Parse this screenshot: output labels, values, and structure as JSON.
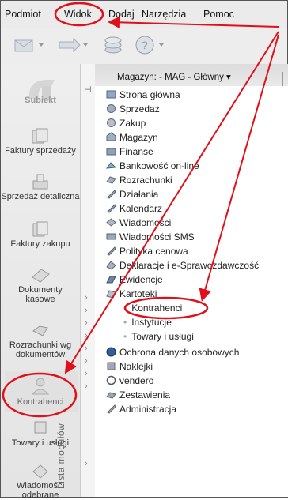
{
  "menu": [
    "Podmiot",
    "Widok",
    "Dodaj",
    "Narzędzia",
    "Pomoc"
  ],
  "logo": "Subiekt",
  "nav": [
    {
      "label": "Faktury sprzedaży",
      "icon": "invoice-icon"
    },
    {
      "label": "Sprzedaż detaliczna",
      "icon": "retail-icon"
    },
    {
      "label": "Faktury zakupu",
      "icon": "purchase-invoice-icon"
    },
    {
      "label": "Dokumenty kasowe",
      "icon": "cash-documents-icon"
    },
    {
      "label": "Rozrachunki wg dokumentów",
      "icon": "settlements-icon"
    },
    {
      "label": "Kontrahenci",
      "icon": "contractors-icon"
    },
    {
      "label": "Towary i usługi",
      "icon": "goods-icon"
    },
    {
      "label": "Wiadomości odebrane",
      "icon": "messages-icon"
    }
  ],
  "panel": {
    "magazyn": "Magazyn: - MAG - Główny ▾",
    "strip_title": "Lista modułów"
  },
  "modules": [
    {
      "label": "Strona główna",
      "icon": "home-icon"
    },
    {
      "label": "Sprzedaż",
      "icon": "sales-icon"
    },
    {
      "label": "Zakup",
      "icon": "purchase-icon"
    },
    {
      "label": "Magazyn",
      "icon": "warehouse-icon"
    },
    {
      "label": "Finanse",
      "icon": "finance-icon"
    },
    {
      "label": "Bankowość on-line",
      "icon": "banking-icon"
    },
    {
      "label": "Rozrachunki",
      "icon": "settlements-icon"
    },
    {
      "label": "Działania",
      "icon": "actions-icon"
    },
    {
      "label": "Kalendarz",
      "icon": "calendar-icon"
    },
    {
      "label": "Wiadomości",
      "icon": "messages-icon"
    },
    {
      "label": "Wiadomości SMS",
      "icon": "sms-icon"
    },
    {
      "label": "Polityka cenowa",
      "icon": "pricing-icon"
    },
    {
      "label": "Deklaracje i e-Sprawozdawczość",
      "icon": "declarations-icon"
    },
    {
      "label": "Ewidencje",
      "icon": "records-icon"
    },
    {
      "label": "Kartoteki",
      "icon": "catalogs-icon"
    }
  ],
  "kartoteki_sub": [
    "Kontrahenci",
    "Instytucje",
    "Towary i usługi"
  ],
  "modules_after": [
    {
      "label": "Ochrona danych osobowych",
      "icon": "data-protection-icon"
    },
    {
      "label": "Naklejki",
      "icon": "labels-icon"
    },
    {
      "label": "vendero",
      "icon": "vendero-icon"
    },
    {
      "label": "Zestawienia",
      "icon": "reports-icon"
    },
    {
      "label": "Administracja",
      "icon": "admin-icon"
    }
  ],
  "colors": {
    "annotation": "#e0101a",
    "highlight_box": "#cccccc"
  }
}
